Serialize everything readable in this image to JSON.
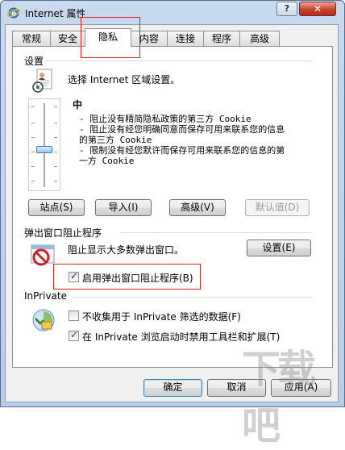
{
  "window": {
    "title": "Internet 属性",
    "help_label": "?",
    "close_label": "✕"
  },
  "tabs": [
    {
      "label": "常规"
    },
    {
      "label": "安全"
    },
    {
      "label": "隐私"
    },
    {
      "label": "内容"
    },
    {
      "label": "连接"
    },
    {
      "label": "程序"
    },
    {
      "label": "高级"
    }
  ],
  "settings": {
    "group_label": "设置",
    "instruction": "选择 Internet 区域设置。",
    "level_title": "中",
    "level_desc_lines": "- 阻止没有精简隐私政策的第三方 Cookie\n- 阻止没有经您明确同意而保存可用来联系您的信息\n的第三方 Cookie\n- 限制没有经您默许而保存可用来联系您的信息的第\n一方 Cookie",
    "slider_level": "中",
    "buttons": {
      "sites": "站点(S)",
      "import": "导入(I)",
      "advanced": "高级(V)",
      "default": "默认值(D)"
    }
  },
  "popup": {
    "group_label": "弹出窗口阻止程序",
    "description": "阻止显示大多数弹出窗口。",
    "settings_button": "设置(E)",
    "enable_label": "启用弹出窗口阻止程序(B)",
    "enable_checked": true
  },
  "inprivate": {
    "group_label": "InPrivate",
    "no_collect_label": "不收集用于 InPrivate 筛选的数据(F)",
    "no_collect_checked": false,
    "disable_toolbars_label": "在 InPrivate 浏览启动时禁用工具栏和扩展(T)",
    "disable_toolbars_checked": true
  },
  "footer": {
    "ok": "确定",
    "cancel": "取消",
    "apply": "应用(A)"
  },
  "watermark": "下载吧"
}
